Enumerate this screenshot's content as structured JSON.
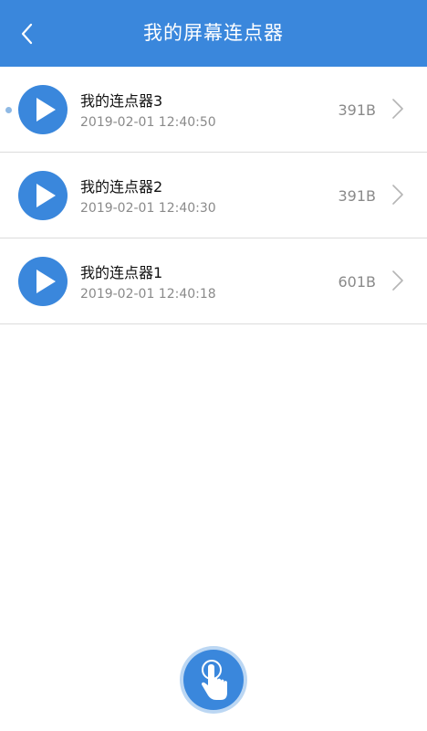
{
  "header": {
    "title": "我的屏幕连点器",
    "back_icon": "chevron-left-icon",
    "color": "#3a87dc"
  },
  "list": {
    "items": [
      {
        "name": "我的连点器3",
        "time": "2019-02-01 12:40:50",
        "size": "391B",
        "active": true
      },
      {
        "name": "我的连点器2",
        "time": "2019-02-01 12:40:30",
        "size": "391B",
        "active": false
      },
      {
        "name": "我的连点器1",
        "time": "2019-02-01 12:40:18",
        "size": "601B",
        "active": false
      }
    ]
  },
  "fab": {
    "icon": "tap-hand-icon"
  }
}
